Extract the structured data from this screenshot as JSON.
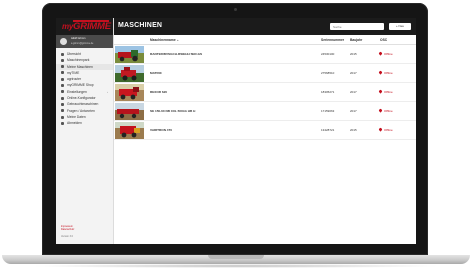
{
  "logo": {
    "prefix": "my",
    "name": "GRIMME"
  },
  "user": {
    "name": "Adolf Grimm",
    "email": "a.grimm@grimme.de"
  },
  "nav": [
    {
      "label": "Übersicht",
      "icon": "home-icon"
    },
    {
      "label": "Maschinenpark",
      "icon": "tractor-icon"
    },
    {
      "label": "Meine Maschinen",
      "icon": "list-icon"
    },
    {
      "label": "myTIME",
      "icon": "clock-icon"
    },
    {
      "label": "agrirouter",
      "icon": "router-icon"
    },
    {
      "label": "myGRIMME Shop",
      "icon": "cart-icon"
    },
    {
      "label": "Einstellungen",
      "icon": "gear-icon",
      "has_children": true
    },
    {
      "label": "Online-Konfigurator",
      "icon": "config-icon"
    },
    {
      "label": "Gebrauchtmaschinen",
      "icon": "truck-icon"
    },
    {
      "label": "Fragen / Antworten",
      "icon": "help-icon"
    },
    {
      "label": "Meine Daten",
      "icon": "user-icon"
    },
    {
      "label": "Abmelden",
      "icon": "logout-icon"
    }
  ],
  "sidebar_footer": {
    "line1": "Impressum",
    "line2": "Datenschutz",
    "version": "Version 3.0"
  },
  "header": {
    "title": "MASCHINEN",
    "search_placeholder": "Suche",
    "new_button": "+ Neu"
  },
  "columns": {
    "name": "Maschinenname",
    "sort": "▲",
    "serial": "Seriennummer",
    "year": "Baujahr",
    "osc": "OSC"
  },
  "rows": [
    {
      "name": "RANTER/BVSGCH-RSIEHH 5ER-GS",
      "serial": "24530100",
      "year": "2015",
      "osc": "Offline"
    },
    {
      "name": "MATRIX",
      "serial": "27568510",
      "year": "2017",
      "osc": "Offline"
    },
    {
      "name": "REXOR 620",
      "serial": "18305271",
      "year": "2017",
      "osc": "Offline"
    },
    {
      "name": "SE 150-60 NB XXL BUGG HB H",
      "serial": "17159063",
      "year": "2017",
      "osc": "Offline"
    },
    {
      "name": "VARITRON 470",
      "serial": "13428721",
      "year": "2015",
      "osc": "Offline"
    }
  ],
  "colors": {
    "brand_red": "#c4101f",
    "topbar": "#1b1b1b",
    "sidebar_bg": "#f3f3f3"
  }
}
